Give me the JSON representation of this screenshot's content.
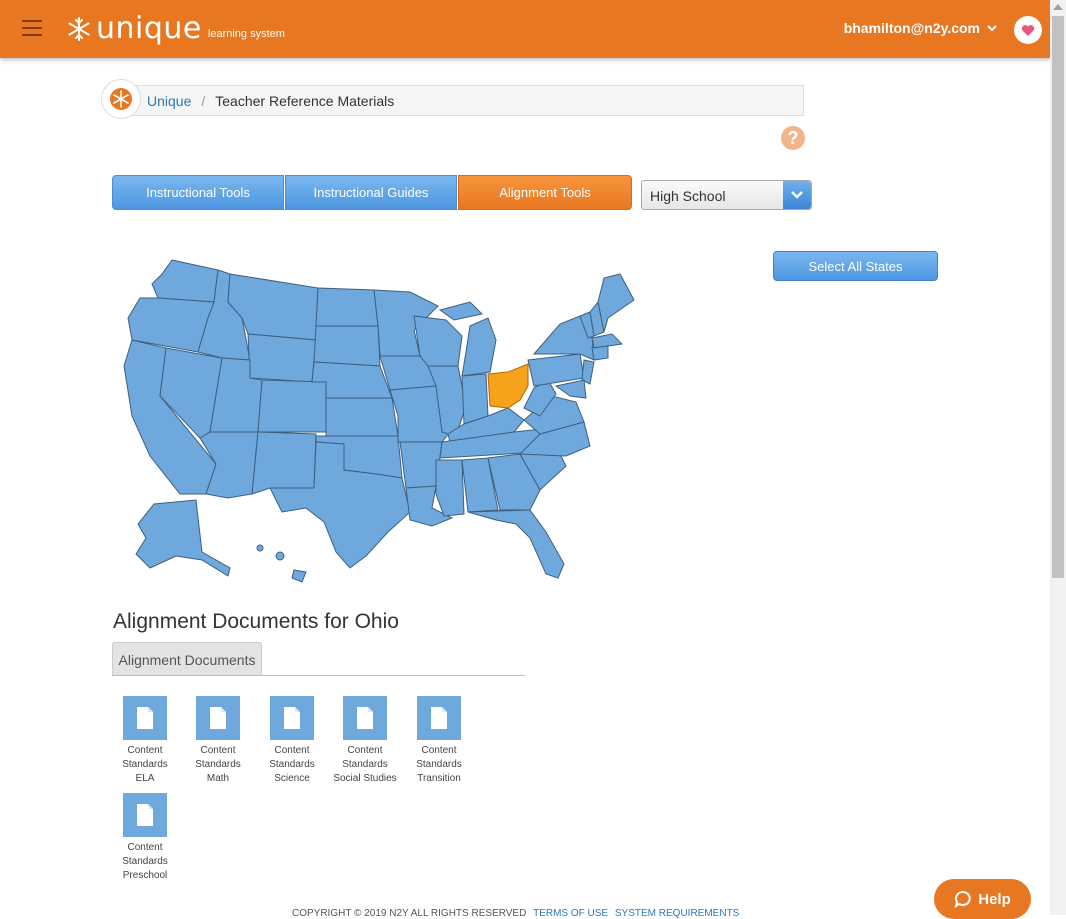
{
  "header": {
    "logo_word": "unique",
    "logo_sub": "learning system",
    "user_email": "bhamilton@n2y.com"
  },
  "breadcrumb": {
    "home": "Unique",
    "separator": "/",
    "current": "Teacher Reference Materials"
  },
  "help_question": "?",
  "tabs": [
    {
      "label": "Instructional Tools",
      "active": false
    },
    {
      "label": "Instructional Guides",
      "active": false
    },
    {
      "label": "Alignment Tools",
      "active": true
    }
  ],
  "level_select": {
    "value": "High School"
  },
  "select_all_label": "Select All States",
  "map": {
    "selected_state": "Ohio",
    "state_color": "#6fa8dc",
    "selected_color": "#f7a21b"
  },
  "docs": {
    "title": "Alignment Documents for Ohio",
    "tab": "Alignment Documents",
    "items": [
      {
        "line1": "Content",
        "line2": "Standards",
        "line3": "ELA"
      },
      {
        "line1": "Content",
        "line2": "Standards",
        "line3": "Math"
      },
      {
        "line1": "Content",
        "line2": "Standards",
        "line3": "Science"
      },
      {
        "line1": "Content",
        "line2": "Standards",
        "line3": "Social Studies"
      },
      {
        "line1": "Content",
        "line2": "Standards",
        "line3": "Transition"
      },
      {
        "line1": "Content",
        "line2": "Standards",
        "line3": "Preschool"
      }
    ]
  },
  "footer": {
    "copyright": "COPYRIGHT © 2019  N2Y ALL RIGHTS RESERVED",
    "terms": "TERMS OF USE",
    "requirements": "SYSTEM REQUIREMENTS"
  },
  "help_button": "Help",
  "colors": {
    "brand_orange": "#e87722",
    "brand_blue": "#4c97e0"
  }
}
